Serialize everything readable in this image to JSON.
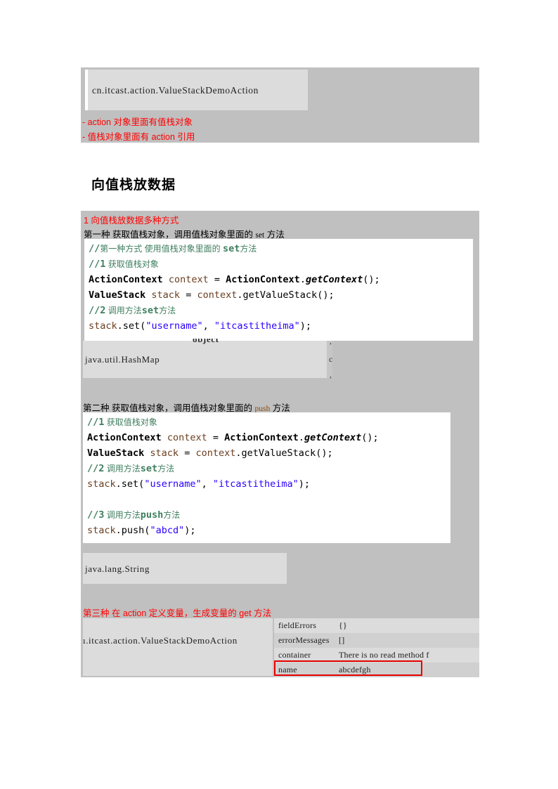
{
  "doc": {
    "title": "向值栈放数据"
  },
  "section_top": {
    "class_box_text": "cn.itcast.action.ValueStackDemoAction",
    "notes": [
      "- action 对象里面有值栈对象",
      "-  值栈对象里面有 action 引用"
    ]
  },
  "section_put": {
    "heading": "向值栈放数据",
    "numbered_note": "1  向值栈放数据多种方式",
    "way1_label_a": "第一种 获取值栈对象，调用值栈对象里面的",
    "way1_label_code": "set",
    "way1_label_b": "方法",
    "code1": {
      "lines": [
        {
          "kind": "comment_cn",
          "slash": "//",
          "text": "第一种方式 使用值栈对象里面的 ",
          "bold": "set",
          "tail": "方法"
        },
        {
          "kind": "comment_num",
          "slash": "//",
          "num": "1",
          "text": " 获取值栈对象"
        },
        {
          "kind": "code",
          "text": "ActionContext context = ActionContext.getContext();"
        },
        {
          "kind": "code",
          "text": "ValueStack stack = context.getValueStack();"
        },
        {
          "kind": "comment_num",
          "slash": "//",
          "num": "2",
          "text": " 调用方法",
          "bold": "set",
          "tail": "方法"
        },
        {
          "kind": "code",
          "text": "stack.set(\"username\", \"itcastitheima\");"
        }
      ]
    },
    "hashmap_box": {
      "clipped_header": "object",
      "text": "java.util.HashMap"
    },
    "way2_label_a": "第二种 获取值栈对象，调用值栈对象里面的",
    "way2_label_code": "push",
    "way2_label_b": "方法",
    "code2": {
      "lines": [
        {
          "kind": "comment_num",
          "slash": "//",
          "num": "1",
          "text": " 获取值栈对象"
        },
        {
          "kind": "code",
          "text": "ActionContext context = ActionContext.getContext();"
        },
        {
          "kind": "code",
          "text": "ValueStack stack = context.getValueStack();"
        },
        {
          "kind": "comment_num",
          "slash": "//",
          "num": "2",
          "text": " 调用方法",
          "bold": "set",
          "tail": "方法"
        },
        {
          "kind": "code",
          "text": "stack.set(\"username\", \"itcastitheima\");"
        },
        {
          "kind": "blank",
          "text": ""
        },
        {
          "kind": "comment_num",
          "slash": "//",
          "num": "3",
          "text": " 调用方法",
          "bold": "push",
          "tail": "方法"
        },
        {
          "kind": "code",
          "text": "stack.push(\"abcd\");"
        }
      ]
    },
    "string_box_text": "java.lang.String",
    "way3_label": "第三种 在 action 定义变量，生成变量的 get 方法",
    "bottom": {
      "left_panel_text": "ı.itcast.action.ValueStackDemoAction",
      "table_rows": [
        {
          "key": "fieldErrors",
          "value": "{}"
        },
        {
          "key": "errorMessages",
          "value": "[]"
        },
        {
          "key": "container",
          "value": "There is no read method f"
        },
        {
          "key": "name",
          "value": "abcdefgh",
          "highlighted": true
        }
      ]
    }
  },
  "colors": {
    "gray_panel": "#c0c0c0",
    "light_box": "#dcdcdc",
    "table_alt": "#d0d0d0",
    "annotation_red": "#ff0000",
    "highlight_red": "#e80000",
    "code_comment": "#3f7f5f",
    "code_string": "#2a00ff",
    "code_variable": "#6a3e1f"
  }
}
